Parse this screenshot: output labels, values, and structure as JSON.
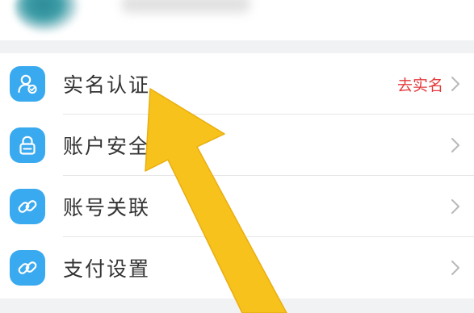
{
  "settings": {
    "items": [
      {
        "label": "实名认证",
        "status": "去实名",
        "icon": "user-verify-icon"
      },
      {
        "label": "账户安全",
        "status": "",
        "icon": "lock-icon"
      },
      {
        "label": "账号关联",
        "status": "",
        "icon": "link-icon"
      },
      {
        "label": "支付设置",
        "status": "",
        "icon": "link-icon"
      }
    ]
  },
  "colors": {
    "icon_bg": "#39a9f0",
    "status_text": "#e4393c",
    "arrow": "#f7c21b",
    "section_gap": "#f1f2f4"
  },
  "annotation": {
    "icon": "pointer-arrow-icon"
  }
}
